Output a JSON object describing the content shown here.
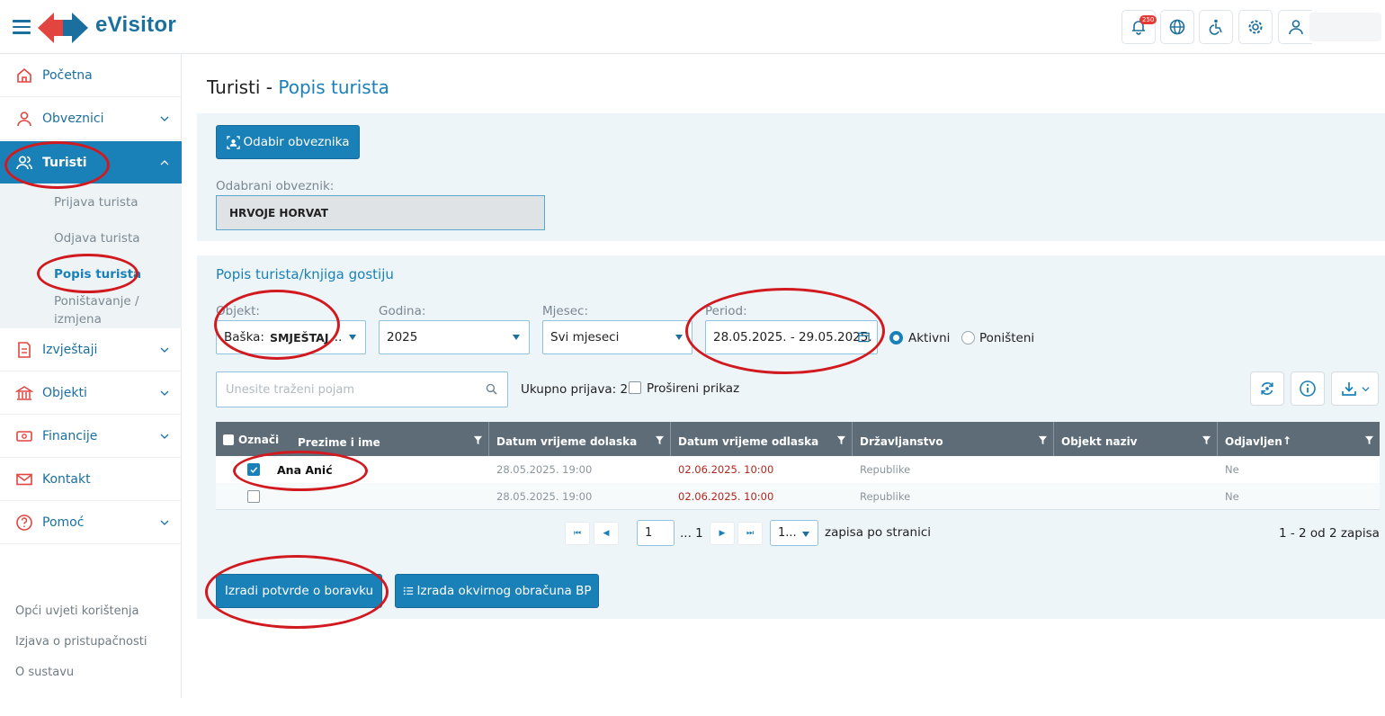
{
  "header": {
    "app_name": "eVisitor",
    "notification_count": "250"
  },
  "sidebar": {
    "items": [
      {
        "label": "Početna"
      },
      {
        "label": "Obveznici"
      },
      {
        "label": "Turisti"
      },
      {
        "label": "Izvještaji"
      },
      {
        "label": "Objekti"
      },
      {
        "label": "Financije"
      },
      {
        "label": "Kontakt"
      },
      {
        "label": "Pomoć"
      }
    ],
    "submenu": [
      {
        "label": "Prijava turista"
      },
      {
        "label": "Odjava turista"
      },
      {
        "label": "Popis turista"
      },
      {
        "label": "Poništavanje /"
      },
      {
        "label": "izmjena"
      }
    ],
    "footer_links": [
      {
        "label": "Opći uvjeti korištenja"
      },
      {
        "label": "Izjava o pristupačnosti"
      },
      {
        "label": "O sustavu"
      }
    ]
  },
  "page": {
    "title_prefix": "Turisti -",
    "title_accent": "Popis turista"
  },
  "taxpayer": {
    "select_button": "Odabir obveznika",
    "selected_label": "Odabrani obveznik:",
    "selected_value": "HRVOJE HORVAT"
  },
  "list": {
    "section_title": "Popis turista/knjiga gostiju",
    "filters": {
      "object_label": "Objekt:",
      "object_value_prefix": "Baška:",
      "object_value_bold": "SMJEŠTAJ",
      "object_value_suffix": "...",
      "year_label": "Godina:",
      "year_value": "2025",
      "month_label": "Mjesec:",
      "month_value": "Svi mjeseci",
      "period_label": "Period:",
      "period_value": "28.05.2025. - 29.05.2025.",
      "status_active": "Aktivni",
      "status_cancelled": "Poništeni"
    },
    "search_placeholder": "Unesite traženi pojam",
    "total_label": "Ukupno prijava: 2",
    "extended_view_label": "Prošireni prikaz",
    "columns": {
      "select": "Označi",
      "name": "Prezime i ime",
      "arrival": "Datum vrijeme dolaska",
      "departure": "Datum vrijeme odlaska",
      "citizenship": "Državljanstvo",
      "object_name": "Objekt naziv",
      "checked_out": "Odjavljen",
      "sort_glyph": "↑"
    },
    "rows": [
      {
        "name": "Ana Anić",
        "arrival": "28.05.2025. 19:00",
        "departure": "02.06.2025. 10:00",
        "citizenship": "Republike",
        "object_name": "",
        "checked_out": "Ne",
        "checked": true
      },
      {
        "name": "",
        "arrival": "28.05.2025. 19:00",
        "departure": "02.06.2025. 10:00",
        "citizenship": "Republike",
        "object_name": "",
        "checked_out": "Ne",
        "checked": false
      }
    ],
    "pager": {
      "first": "⏮",
      "prev": "◀",
      "page": "1",
      "of_pages": "... 1",
      "next": "▶",
      "last": "⏭",
      "page_size": "1...",
      "per_page_label": "zapisa po stranici",
      "range_label": "1 - 2 od 2 zapisa"
    },
    "actions": {
      "create_confirmations": "Izradi potvrde o boravku",
      "create_bp": "Izrada okvirnog obračuna BP"
    }
  },
  "colors": {
    "primary": "#1a81b8",
    "annotation_red": "#d11a1f",
    "header_grid": "#5e6c78"
  }
}
